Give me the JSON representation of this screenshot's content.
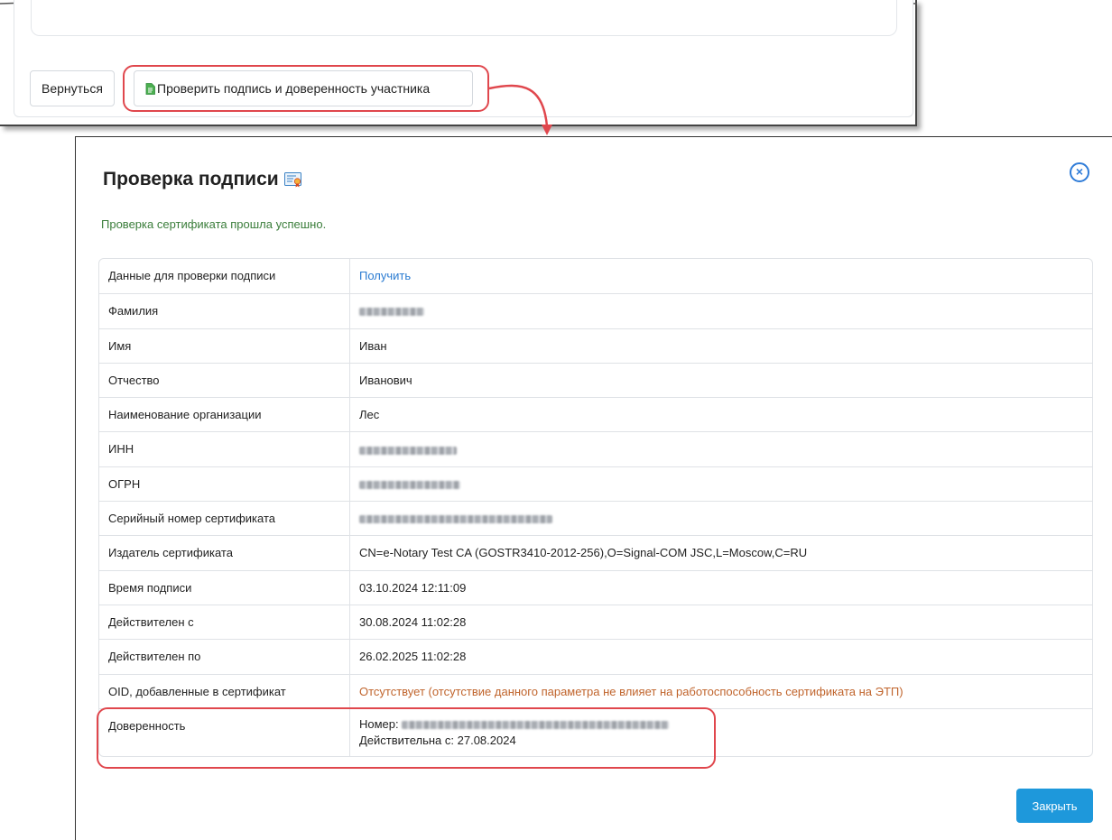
{
  "top_page": {
    "back_button": "Вернуться",
    "check_button": "Проверить подпись и доверенность участника"
  },
  "modal": {
    "title": "Проверка подписи",
    "success_message": "Проверка сертификата прошла успешно.",
    "close_button": "Закрыть",
    "rows": {
      "verify_data": {
        "label": "Данные для проверки подписи",
        "value": "Получить"
      },
      "surname": {
        "label": "Фамилия"
      },
      "name": {
        "label": "Имя",
        "value": "Иван"
      },
      "patronymic": {
        "label": "Отчество",
        "value": "Иванович"
      },
      "org": {
        "label": "Наименование организации",
        "value": "Лес"
      },
      "inn": {
        "label": "ИНН"
      },
      "ogrn": {
        "label": "ОГРН"
      },
      "serial": {
        "label": "Серийный номер сертификата"
      },
      "issuer": {
        "label": "Издатель сертификата",
        "value": "CN=e-Notary Test CA (GOSTR3410-2012-256),O=Signal-COM JSC,L=Moscow,C=RU"
      },
      "sign_time": {
        "label": "Время подписи",
        "value": "03.10.2024 12:11:09"
      },
      "valid_from": {
        "label": "Действителен с",
        "value": "30.08.2024 11:02:28"
      },
      "valid_to": {
        "label": "Действителен по",
        "value": "26.02.2025 11:02:28"
      },
      "oid": {
        "label": "OID, добавленные в сертификат",
        "value": "Отсутствует (отсутствие данного параметра не влияет на работоспособность сертификата на ЭТП)"
      },
      "power_of_attorney": {
        "label": "Доверенность",
        "number_prefix": "Номер:",
        "valid_since": "Действительна с: 27.08.2024"
      }
    }
  },
  "colors": {
    "success": "#3a7d3a",
    "link": "#2a7bd1",
    "warning": "#c0642c",
    "primary_button": "#1e98db",
    "annotation": "#e0474d"
  }
}
